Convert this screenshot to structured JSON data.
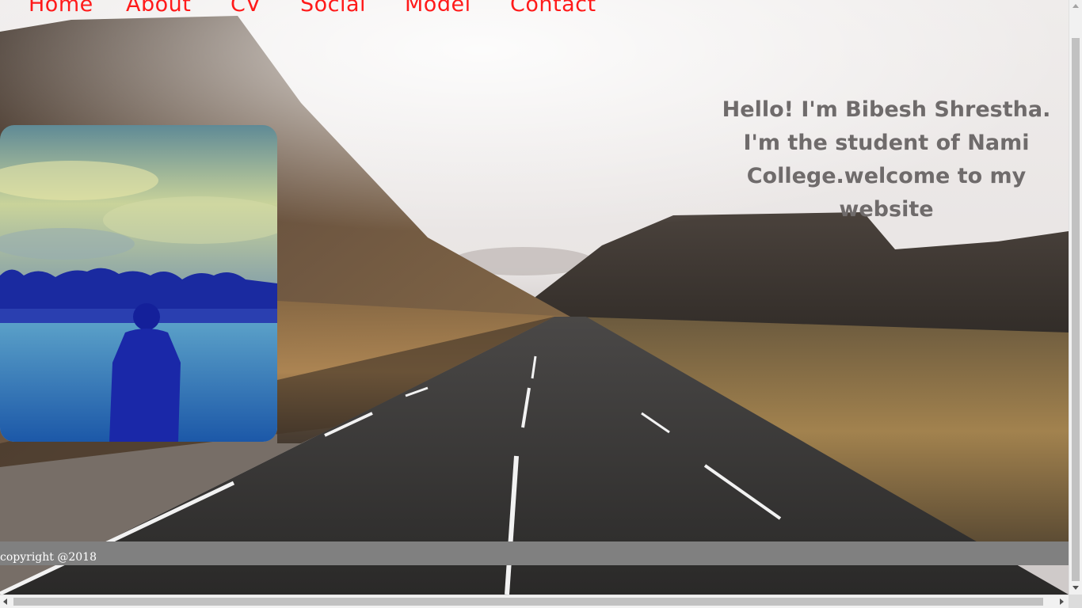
{
  "nav": {
    "items": [
      {
        "label": "Home"
      },
      {
        "label": "About"
      },
      {
        "label": "CV"
      },
      {
        "label": "Social"
      },
      {
        "label": "Model"
      },
      {
        "label": "Contact"
      }
    ]
  },
  "intro": {
    "line1": "Hello! I'm Bibesh Shrestha.",
    "line2": "I'm the student of Nami",
    "line3": "College.welcome to my website"
  },
  "footer": {
    "copyright": "copyright @2018"
  },
  "colors": {
    "nav_link": "#ff1a1a",
    "intro_text": "#6f6b6b",
    "footer_bg": "#808080",
    "footer_text": "#ffffff"
  },
  "icons": {
    "scroll_up": "triangle-up-icon",
    "scroll_down": "triangle-down-icon",
    "scroll_left": "triangle-left-icon",
    "scroll_right": "triangle-right-icon"
  }
}
